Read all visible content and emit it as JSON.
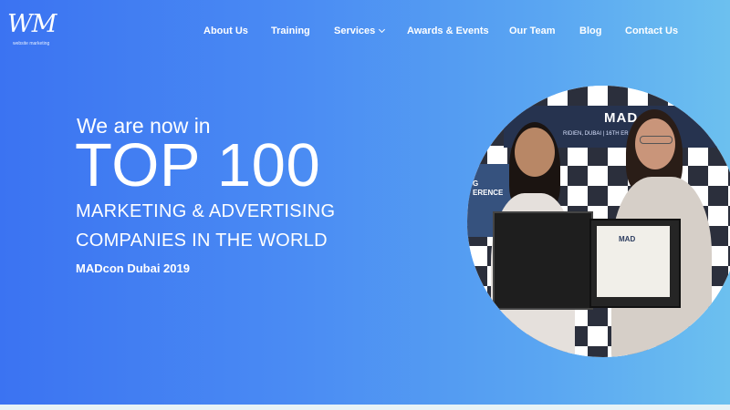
{
  "logo": {
    "mark": "WM",
    "tagline": "website marketing"
  },
  "nav": {
    "items": [
      {
        "label": "About Us"
      },
      {
        "label": "Training"
      },
      {
        "label": "Services"
      },
      {
        "label": "Awards & Events"
      },
      {
        "label": "Our Team"
      },
      {
        "label": "Blog"
      },
      {
        "label": "Contact Us"
      }
    ]
  },
  "hero": {
    "intro": "We are now in",
    "headline": "TOP 100",
    "subline1": "MARKETING & ADVERTISING",
    "subline2": "COMPANIES IN THE WORLD",
    "event": "MADcon Dubai 2019"
  },
  "photo": {
    "banner_logo": "MAD",
    "banner_sub": "RIDIEN, DUBAI | 16TH    ER, 2019",
    "side_text": "G ERENCE",
    "certificate_logo": "MAD"
  },
  "colors": {
    "gradient_start": "#3b73f2",
    "gradient_end": "#6cc0ef",
    "text": "#ffffff"
  }
}
